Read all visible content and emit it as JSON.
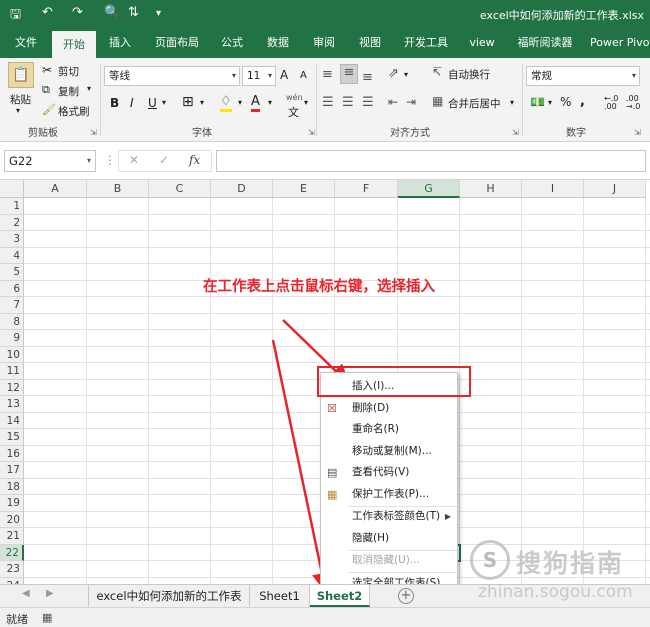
{
  "window": {
    "title": "excel中如何添加新的工作表.xlsx",
    "save_icon": "save-icon",
    "undo_icon": "undo-icon",
    "redo_icon": "redo-icon"
  },
  "ribbon_tabs": [
    "文件",
    "开始",
    "插入",
    "页面布局",
    "公式",
    "数据",
    "审阅",
    "视图",
    "开发工具",
    "view",
    "福昕阅读器",
    "Power Pivot"
  ],
  "active_tab": "开始",
  "clipboard": {
    "paste": "粘贴",
    "cut": "剪切",
    "copy": "复制",
    "format_painter": "格式刷",
    "group_label": "剪贴板"
  },
  "font": {
    "name": "等线",
    "size": "11",
    "grow": "A",
    "shrink": "A",
    "bold": "B",
    "italic": "I",
    "underline": "U",
    "wen": "wén",
    "group_label": "字体"
  },
  "alignment": {
    "wrap_text": "自动换行",
    "merge_center": "合并后居中",
    "group_label": "对齐方式"
  },
  "number": {
    "format": "常规",
    "percent": "%",
    "comma": ",",
    "group_label": "数字"
  },
  "formula_bar": {
    "name_box": "G22",
    "cancel": "✕",
    "enter": "✓",
    "fx": "fx",
    "value": ""
  },
  "grid": {
    "columns": [
      "A",
      "B",
      "C",
      "D",
      "E",
      "F",
      "G",
      "H",
      "I",
      "J"
    ],
    "rows": [
      "1",
      "2",
      "3",
      "4",
      "5",
      "6",
      "7",
      "8",
      "9",
      "10",
      "11",
      "12",
      "13",
      "14",
      "15",
      "16",
      "17",
      "18",
      "19",
      "20",
      "21",
      "22",
      "23",
      "24"
    ],
    "selected_column": "G",
    "selected_row": "22"
  },
  "annotation": {
    "text": "在工作表上点击鼠标右键，选择插入",
    "color": "#e8232b"
  },
  "context_menu": {
    "items": [
      {
        "label": "插入(I)...",
        "icon": "",
        "disabled": false
      },
      {
        "label": "删除(D)",
        "icon": "delete-sheet-icon",
        "disabled": false
      },
      {
        "label": "重命名(R)",
        "icon": "",
        "disabled": false
      },
      {
        "label": "移动或复制(M)...",
        "icon": "",
        "disabled": false
      },
      {
        "label": "查看代码(V)",
        "icon": "view-code-icon",
        "disabled": false
      },
      {
        "label": "保护工作表(P)...",
        "icon": "protect-sheet-icon",
        "disabled": false
      },
      {
        "label": "工作表标签颜色(T)",
        "icon": "",
        "disabled": false,
        "submenu": true
      },
      {
        "label": "隐藏(H)",
        "icon": "",
        "disabled": false
      },
      {
        "label": "取消隐藏(U)...",
        "icon": "",
        "disabled": true
      },
      {
        "label": "选定全部工作表(S)",
        "icon": "",
        "disabled": false
      }
    ]
  },
  "sheet_tabs": [
    "excel中如何添加新的工作表",
    "Sheet1",
    "Sheet2"
  ],
  "active_sheet": "Sheet2",
  "status": {
    "ready": "就绪"
  },
  "watermark": {
    "cn": "搜狗指南",
    "url": "zhinan.sogou.com",
    "logo": "S"
  },
  "colors": {
    "brand": "#217346",
    "ribbon_bg": "#f3f3f3",
    "annotation_red": "#e8232b"
  }
}
